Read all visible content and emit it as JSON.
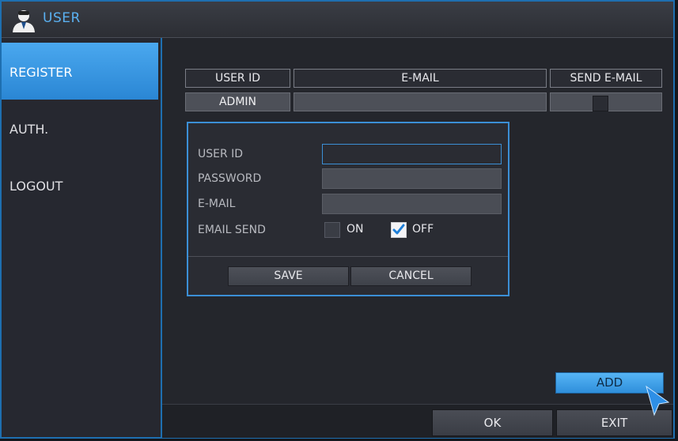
{
  "window": {
    "title": "USER",
    "title_icon": "user-icon",
    "accent": "#1e6fb0"
  },
  "sidebar": {
    "items": [
      {
        "label": "REGISTER",
        "active": true
      },
      {
        "label": "AUTH.",
        "active": false
      },
      {
        "label": "LOGOUT",
        "active": false
      }
    ]
  },
  "table": {
    "headers": [
      "USER ID",
      "E-MAIL",
      "SEND E-MAIL"
    ],
    "rows": [
      {
        "user_id": "ADMIN",
        "email": "",
        "send_email": false
      }
    ]
  },
  "dialog": {
    "labels": {
      "user_id": "USER ID",
      "password": "PASSWORD",
      "email": "E-MAIL",
      "email_send": "EMAIL SEND"
    },
    "values": {
      "user_id": "",
      "password": "",
      "email": ""
    },
    "email_send": {
      "on_label": "ON",
      "off_label": "OFF",
      "selected": "OFF"
    },
    "buttons": {
      "save": "SAVE",
      "cancel": "CANCEL"
    }
  },
  "actions": {
    "add": "ADD",
    "ok": "OK",
    "exit": "EXIT"
  }
}
